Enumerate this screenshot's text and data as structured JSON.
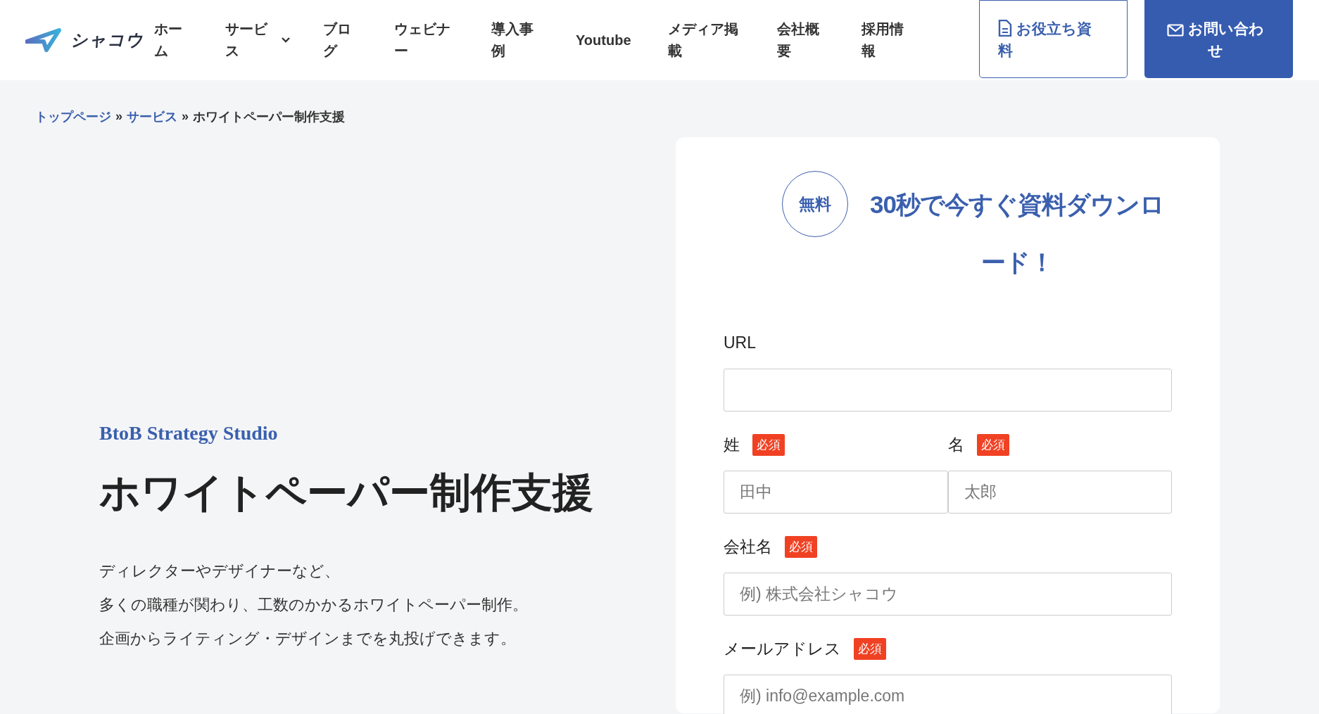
{
  "header": {
    "logo": "シャコウ",
    "nav": [
      {
        "label": "ホーム",
        "has_dropdown": false
      },
      {
        "label": "サービス",
        "has_dropdown": true
      },
      {
        "label": "ブログ",
        "has_dropdown": false
      },
      {
        "label": "ウェビナー",
        "has_dropdown": false
      },
      {
        "label": "導入事例",
        "has_dropdown": false
      },
      {
        "label": "Youtube",
        "has_dropdown": false
      },
      {
        "label": "メディア掲載",
        "has_dropdown": false
      },
      {
        "label": "会社概要",
        "has_dropdown": false
      },
      {
        "label": "採用情報",
        "has_dropdown": false
      }
    ],
    "buttons": [
      {
        "label": "お役立ち資料",
        "kind": "outline"
      },
      {
        "label": "お問い合わせ",
        "kind": "filled"
      }
    ]
  },
  "breadcrumb": {
    "separator": "»",
    "items": [
      {
        "label": "トップページ",
        "link": true
      },
      {
        "label": "サービス",
        "link": true
      },
      {
        "label": "ホワイトペーパー制作支援",
        "link": false
      }
    ]
  },
  "hero": {
    "tagline": "BtoB Strategy Studio",
    "title": "ホワイトペーパー制作支援",
    "lines": [
      "ディレクターやデザイナーなど、",
      "多くの職種が関わり、工数のかかるホワイトペーパー制作。",
      "企画からライティング・デザインまでを丸投げできます。"
    ]
  },
  "form": {
    "badge": "無料",
    "heading": "30秒で今すぐ資料ダウンロード！",
    "rows": [
      [
        {
          "label": "URL"
        }
      ],
      [
        {
          "label": "姓",
          "required": "必須",
          "placeholder": "田中"
        },
        {
          "label": "名",
          "required": "必須",
          "placeholder": "太郎"
        }
      ],
      [
        {
          "label": "会社名",
          "required": "必須",
          "placeholder": "例) 株式会社シャコウ"
        }
      ],
      [
        {
          "label": "メールアドレス",
          "required": "必須",
          "placeholder": "例) info@example.com"
        }
      ]
    ]
  }
}
